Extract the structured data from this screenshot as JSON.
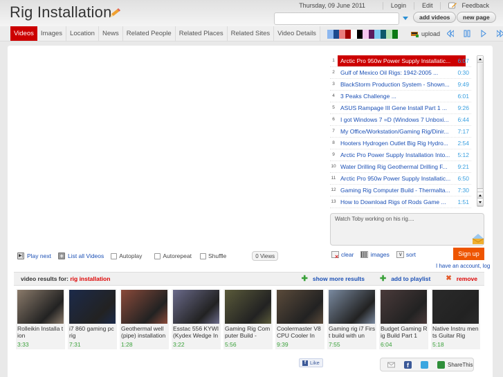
{
  "header": {
    "title": "Rig Installation",
    "date": "Thursday, 09 June 2011",
    "links": [
      "Login",
      "Edit",
      "Feedback"
    ],
    "search": {
      "value": "",
      "placeholder": ""
    },
    "buttons": {
      "add_videos": "add videos",
      "new_page": "new page"
    }
  },
  "nav": {
    "tabs": [
      {
        "label": "Videos",
        "active": true
      },
      {
        "label": "Images"
      },
      {
        "label": "Location"
      },
      {
        "label": "News"
      },
      {
        "label": "Related People"
      },
      {
        "label": "Related Places"
      },
      {
        "label": "Related Sites"
      },
      {
        "label": "Video Details"
      }
    ],
    "swatches": [
      "#8db8f0",
      "#1c4a8f",
      "#e87c7c",
      "#a00000",
      "#ffffff",
      "#000000",
      "#f7c6ef",
      "#5a1c5e",
      "#7ccaf0",
      "#0c5a6a",
      "#b4e3b4",
      "#0c7a14"
    ],
    "upload_label": "upload",
    "player_controls": [
      "rewind-icon",
      "pause-icon",
      "play-icon",
      "fast-forward-icon"
    ]
  },
  "playlist": {
    "items": [
      {
        "num": "1",
        "title": "Arctic Pro 950w Power Supply Installatic...",
        "duration": "6:07",
        "active": true
      },
      {
        "num": "2",
        "title": "Gulf of Mexico Oil Rigs: 1942-2005      ...",
        "duration": "0:30"
      },
      {
        "num": "3",
        "title": "BlackStorm Production System - Shown...",
        "duration": "9:49"
      },
      {
        "num": "4",
        "title": "3 Peaks Challenge                       ...",
        "duration": "6:01"
      },
      {
        "num": "5",
        "title": "ASUS Rampage III Gene Install Part 1  ...",
        "duration": "9:26"
      },
      {
        "num": "6",
        "title": "I got Windows 7 =D (Windows 7 Unboxi...",
        "duration": "6:44"
      },
      {
        "num": "7",
        "title": "My Office/Workstation/Gaming Rig/Dinir...",
        "duration": "7:17"
      },
      {
        "num": "8",
        "title": "Hooters Hydrogen Outlet Big Rig Hydro...",
        "duration": "2:54"
      },
      {
        "num": "9",
        "title": "Arctic Pro Power Supply Installation Into...",
        "duration": "5:12"
      },
      {
        "num": "10",
        "title": "Water Drilling Rig Geothermal Drilling F...",
        "duration": "9:21"
      },
      {
        "num": "11",
        "title": "Arctic Pro 950w Power Supply Installatic...",
        "duration": "6:50"
      },
      {
        "num": "12",
        "title": "Gaming Rig Computer Build - Thermalta...",
        "duration": "7:30"
      },
      {
        "num": "13",
        "title": "How to Download Rigs of Rods Game   ...",
        "duration": "1:51"
      }
    ],
    "comment": "Watch Toby working on his rig....",
    "tools": {
      "clear": "clear",
      "images": "images",
      "sort": "sort"
    },
    "signup": "Sign up",
    "account_link": "I have an account, log"
  },
  "controls": {
    "play_next": "Play next",
    "list_all": "List all Videos",
    "autoplay": "Autoplay",
    "autorepeat": "Autorepeat",
    "shuffle": "Shuffle",
    "views": "0 Views"
  },
  "results": {
    "label": "video results for:",
    "query": "rig installation",
    "show_more": "show more results",
    "add_playlist": "add to playlist",
    "remove": "remove",
    "videos": [
      {
        "title": "Rolleikin Installa tion",
        "duration": "3:33",
        "color": "#8a7a6a"
      },
      {
        "title": "i7 860 gaming pc rig",
        "duration": "7:31",
        "color": "#1c2a4a"
      },
      {
        "title": "Geothermal well (pipe) installation",
        "duration": "1:28",
        "color": "#8a4a3a"
      },
      {
        "title": "Esstac 556 KYWI (Kydex Wedge In",
        "duration": "3:22",
        "color": "#6a6a8a"
      },
      {
        "title": "Gaming Rig Com puter Build -",
        "duration": "5:56",
        "color": "#5a5a3a"
      },
      {
        "title": "Coolermaster V8 CPU Cooler In",
        "duration": "9:39",
        "color": "#5a4a3a"
      },
      {
        "title": "Gaming rig i7 First build with un",
        "duration": "7:55",
        "color": "#7a8aa0"
      },
      {
        "title": "Budget Gaming Rig Build Part 1",
        "duration": "6:04",
        "color": "#4a3a3a"
      },
      {
        "title": "Native Instru ments Guitar Rig",
        "duration": "5:18",
        "color": "#2a2a2a"
      }
    ]
  },
  "footer": {
    "like": "Like",
    "share_label": "ShareThis"
  }
}
